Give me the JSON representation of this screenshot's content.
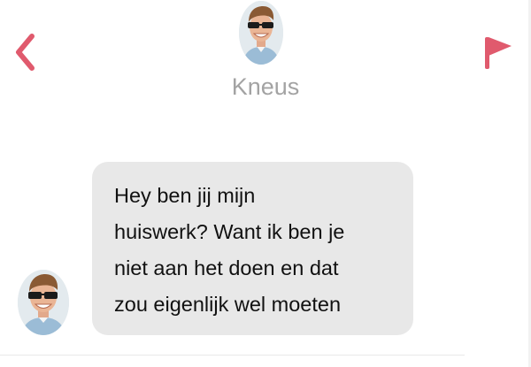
{
  "header": {
    "contact_name": "Kneus",
    "back_icon": "chevron-left-icon",
    "flag_icon": "flag-icon",
    "accent_color": "#e05a6d"
  },
  "conversation": {
    "messages": [
      {
        "lines": [
          "Hey ben jij mijn",
          "huiswerk? Want ik ben je",
          "niet aan het doen en dat",
          "zou eigenlijk wel moeten"
        ]
      }
    ]
  }
}
